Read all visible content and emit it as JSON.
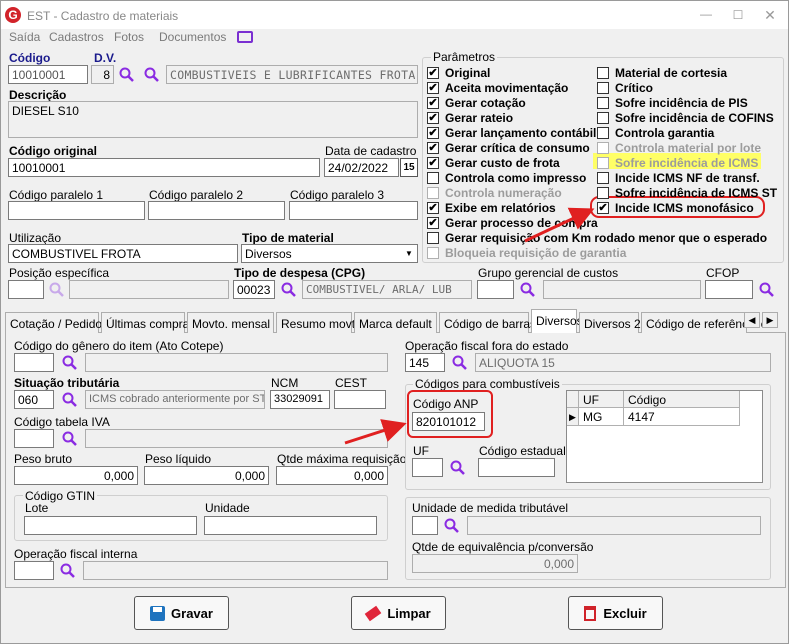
{
  "window": {
    "title": "EST - Cadastro de materiais"
  },
  "menu": [
    "Saída",
    "Cadastros",
    "Fotos",
    "Documentos"
  ],
  "header": {
    "codigo_label": "Código",
    "codigo": "10010001",
    "dv_label": "D.V.",
    "dv": "8",
    "grupo": "COMBUSTIVEIS E LUBRIFICANTES FROTA",
    "descricao_label": "Descrição",
    "descricao": "DIESEL S10",
    "codigo_original_label": "Código original",
    "codigo_original": "10010001",
    "data_cadastro_label": "Data de cadastro",
    "data_cadastro": "24/02/2022",
    "cal_label": "15",
    "cp1_label": "Código paralelo 1",
    "cp2_label": "Código paralelo 2",
    "cp3_label": "Código paralelo 3",
    "utilizacao_label": "Utilização",
    "utilizacao": "COMBUSTIVEL FROTA",
    "tipo_material_label": "Tipo de material",
    "tipo_material": "Diversos",
    "posicao_label": "Posição específica",
    "tipo_despesa_label": "Tipo de despesa (CPG)",
    "tipo_despesa_code": "00023",
    "tipo_despesa": "COMBUSTIVEL/ ARLA/ LUB",
    "grupo_gerencial_label": "Grupo gerencial de custos",
    "cfop_label": "CFOP"
  },
  "parametros": {
    "title": "Parâmetros",
    "left": [
      {
        "label": "Original",
        "checked": true,
        "disabled": false
      },
      {
        "label": "Aceita movimentação",
        "checked": true,
        "disabled": false
      },
      {
        "label": "Gerar cotação",
        "checked": true,
        "disabled": false
      },
      {
        "label": "Gerar rateio",
        "checked": true,
        "disabled": false
      },
      {
        "label": "Gerar lançamento contábil",
        "checked": true,
        "disabled": false
      },
      {
        "label": "Gerar crítica de consumo",
        "checked": true,
        "disabled": false
      },
      {
        "label": "Gerar custo de frota",
        "checked": true,
        "disabled": false
      },
      {
        "label": "Controla como impresso",
        "checked": false,
        "disabled": false
      },
      {
        "label": "Controla numeração",
        "checked": false,
        "disabled": true
      },
      {
        "label": "Exibe em relatórios",
        "checked": true,
        "disabled": false
      },
      {
        "label": "Gerar processo de compra",
        "checked": true,
        "disabled": false
      },
      {
        "label": "Gerar requisição com Km rodado menor que o esperado",
        "checked": false,
        "disabled": false
      },
      {
        "label": "Bloqueia requisição de garantia",
        "checked": false,
        "disabled": true
      }
    ],
    "right": [
      {
        "label": "Material de cortesia",
        "checked": false,
        "disabled": false
      },
      {
        "label": "Crítico",
        "checked": false,
        "disabled": false
      },
      {
        "label": "Sofre incidência de PIS",
        "checked": false,
        "disabled": false
      },
      {
        "label": "Sofre incidência de COFINS",
        "checked": false,
        "disabled": false
      },
      {
        "label": "Controla garantia",
        "checked": false,
        "disabled": false
      },
      {
        "label": "Controla material por lote",
        "checked": false,
        "disabled": true
      },
      {
        "label": "Sofre incidência de ICMS",
        "checked": false,
        "disabled": true
      },
      {
        "label": "Incide ICMS NF de transf.",
        "checked": false,
        "disabled": false
      },
      {
        "label": "Sofre incidência de ICMS ST",
        "checked": false,
        "disabled": false
      },
      {
        "label": "Incide ICMS monofásico",
        "checked": true,
        "disabled": false
      }
    ]
  },
  "tabs": [
    "Cotação / Pedido",
    "Últimas compras",
    "Movto. mensal",
    "Resumo movto.",
    "Marca default",
    "Código de barras",
    "Diversos",
    "Diversos 2",
    "Código de referência c"
  ],
  "diversos": {
    "genero_label": "Código do gênero do item (Ato Cotepe)",
    "op_fora_label": "Operação fiscal fora do estado",
    "op_fora_code": "145",
    "op_fora": "ALIQUOTA 15",
    "sit_trib_label": "Situação tributária",
    "sit_trib_code": "060",
    "sit_trib": "ICMS cobrado anteriormente por ST",
    "ncm_label": "NCM",
    "ncm": "33029091",
    "cest_label": "CEST",
    "iva_label": "Código tabela IVA",
    "peso_bruto_label": "Peso bruto",
    "peso_bruto": "0,000",
    "peso_liquido_label": "Peso líquido",
    "peso_liquido": "0,000",
    "qtde_max_label": "Qtde máxima requisição",
    "qtde_max": "0,000",
    "gtin_label": "Código GTIN",
    "lote_label": "Lote",
    "unidade_label": "Unidade",
    "op_interna_label": "Operação fiscal interna",
    "comb_title": "Códigos para combustíveis",
    "anp_label": "Código ANP",
    "anp": "820101012",
    "uf_label": "UF",
    "cod_estadual_label": "Código estadual",
    "grid": {
      "headers": [
        "UF",
        "Código"
      ],
      "rows": [
        [
          "MG",
          "4147"
        ]
      ]
    },
    "unidade_trib_label": "Unidade de medida tributável",
    "equiv_label": "Qtde de equivalência p/conversão",
    "equiv": "0,000"
  },
  "buttons": {
    "gravar": "Gravar",
    "limpar": "Limpar",
    "excluir": "Excluir"
  },
  "colors": {
    "highlight": "#ffff66",
    "annotation": "#e02020",
    "accent": "#7a2fd1"
  }
}
